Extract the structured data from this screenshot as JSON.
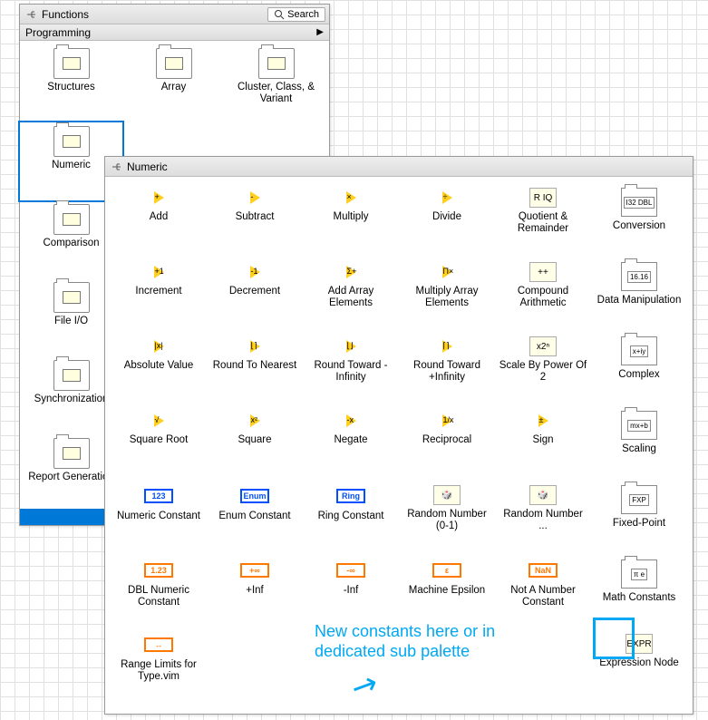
{
  "functions": {
    "title": "Functions",
    "search_label": "Search",
    "subheader": "Programming",
    "items": [
      {
        "label": "Structures"
      },
      {
        "label": "Array"
      },
      {
        "label": "Cluster, Class, & Variant"
      },
      {
        "label": "Numeric"
      },
      {
        "label": ""
      },
      {
        "label": ""
      },
      {
        "label": "Comparison"
      },
      {
        "label": ""
      },
      {
        "label": ""
      },
      {
        "label": "File I/O"
      },
      {
        "label": ""
      },
      {
        "label": ""
      },
      {
        "label": "Synchronization"
      },
      {
        "label": ""
      },
      {
        "label": ""
      },
      {
        "label": "Report Generation"
      }
    ],
    "selected_index": 3
  },
  "numeric": {
    "title": "Numeric",
    "items": [
      {
        "label": "Add",
        "sym": "+",
        "type": "tri"
      },
      {
        "label": "Subtract",
        "sym": "-",
        "type": "tri"
      },
      {
        "label": "Multiply",
        "sym": "×",
        "type": "tri"
      },
      {
        "label": "Divide",
        "sym": "÷",
        "type": "tri"
      },
      {
        "label": "Quotient & Remainder",
        "sym": "R IQ",
        "type": "box"
      },
      {
        "label": "Conversion",
        "sym": "I32 DBL",
        "type": "folder"
      },
      {
        "label": "Increment",
        "sym": "+1",
        "type": "tri"
      },
      {
        "label": "Decrement",
        "sym": "-1",
        "type": "tri"
      },
      {
        "label": "Add Array Elements",
        "sym": "Σ+",
        "type": "tri"
      },
      {
        "label": "Multiply Array Elements",
        "sym": "Π×",
        "type": "tri"
      },
      {
        "label": "Compound Arithmetic",
        "sym": "++",
        "type": "box"
      },
      {
        "label": "Data Manipulation",
        "sym": "16.16",
        "type": "folder"
      },
      {
        "label": "Absolute Value",
        "sym": "|x|",
        "type": "tri"
      },
      {
        "label": "Round To Nearest",
        "sym": "⌊⌉",
        "type": "tri"
      },
      {
        "label": "Round Toward -Infinity",
        "sym": "⌊⌋",
        "type": "tri"
      },
      {
        "label": "Round Toward +Infinity",
        "sym": "⌈⌉",
        "type": "tri"
      },
      {
        "label": "Scale By Power Of 2",
        "sym": "x2ⁿ",
        "type": "box"
      },
      {
        "label": "Complex",
        "sym": "x+iy",
        "type": "folder"
      },
      {
        "label": "Square Root",
        "sym": "√",
        "type": "tri"
      },
      {
        "label": "Square",
        "sym": "x²",
        "type": "tri"
      },
      {
        "label": "Negate",
        "sym": "-x",
        "type": "tri"
      },
      {
        "label": "Reciprocal",
        "sym": "1/x",
        "type": "tri"
      },
      {
        "label": "Sign",
        "sym": "±",
        "type": "tri"
      },
      {
        "label": "Scaling",
        "sym": "mx+b",
        "type": "folder"
      },
      {
        "label": "Numeric Constant",
        "sym": "123",
        "type": "const",
        "color": "#0050ff"
      },
      {
        "label": "Enum Constant",
        "sym": "Enum",
        "type": "const",
        "color": "#0050ff"
      },
      {
        "label": "Ring Constant",
        "sym": "Ring",
        "type": "const",
        "color": "#0050ff"
      },
      {
        "label": "Random Number (0-1)",
        "sym": "🎲",
        "type": "box"
      },
      {
        "label": "Random Number ...",
        "sym": "🎲",
        "type": "box"
      },
      {
        "label": "Fixed-Point",
        "sym": "FXP",
        "type": "folder"
      },
      {
        "label": "DBL Numeric Constant",
        "sym": "1.23",
        "type": "const",
        "color": "#ff7800"
      },
      {
        "label": "+Inf",
        "sym": "+∞",
        "type": "const",
        "color": "#ff7800"
      },
      {
        "label": "-Inf",
        "sym": "-∞",
        "type": "const",
        "color": "#ff7800"
      },
      {
        "label": "Machine Epsilon",
        "sym": "ε",
        "type": "const",
        "color": "#ff7800"
      },
      {
        "label": "Not A Number Constant",
        "sym": "NaN",
        "type": "const",
        "color": "#ff7800"
      },
      {
        "label": "Math Constants",
        "sym": "π e",
        "type": "folder"
      },
      {
        "label": "Range Limits for Type.vim",
        "sym": "↔",
        "type": "const",
        "color": "#ff7800"
      },
      {
        "label": "",
        "type": "blank"
      },
      {
        "label": "",
        "type": "blank"
      },
      {
        "label": "",
        "type": "blank"
      },
      {
        "label": "",
        "type": "blank"
      },
      {
        "label": "Expression Node",
        "sym": "EXPR",
        "type": "box"
      }
    ]
  },
  "annotation": {
    "text_line1": "New constants here or in",
    "text_line2": "dedicated sub palette"
  }
}
